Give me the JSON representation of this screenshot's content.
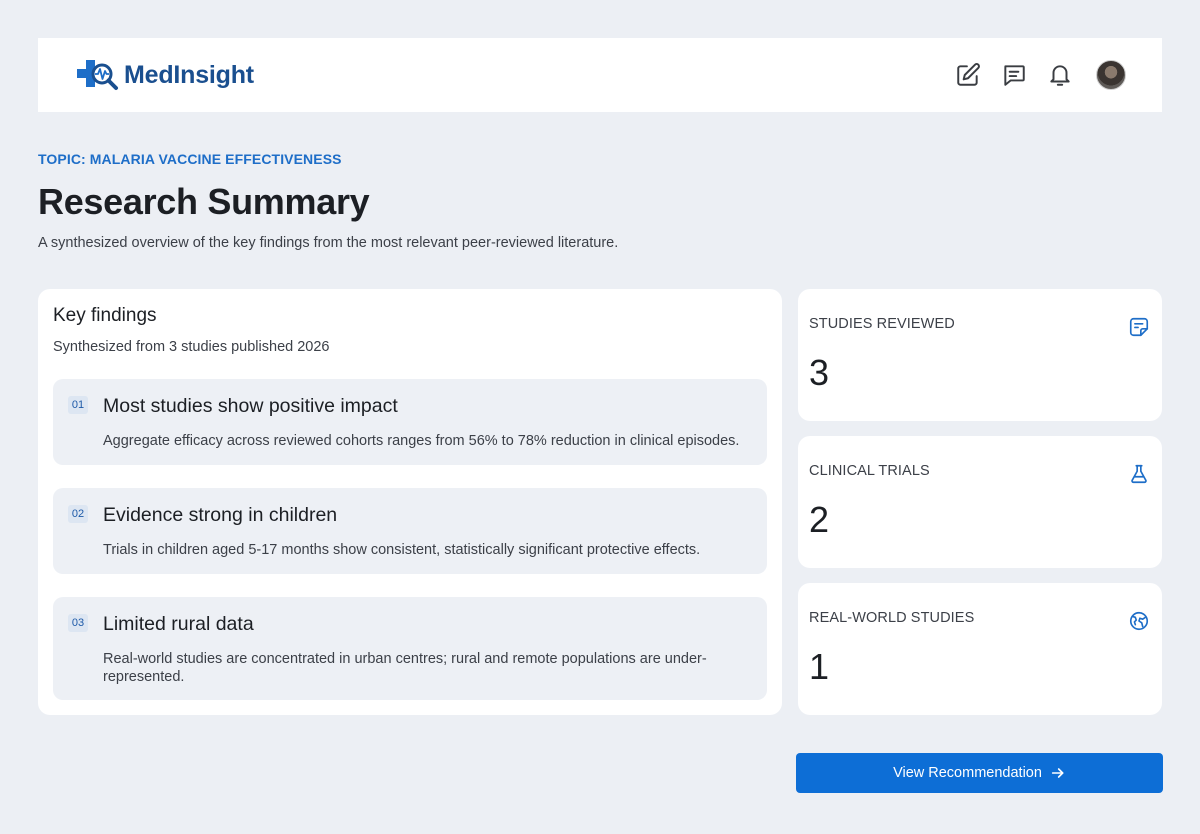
{
  "brand": {
    "name": "MedInsight",
    "accent": "#1e6ec8",
    "primary": "#0d6ed6"
  },
  "header": {
    "actions": [
      {
        "icon": "edit-icon"
      },
      {
        "icon": "message-icon"
      },
      {
        "icon": "bell-icon"
      }
    ],
    "avatar": "user-avatar"
  },
  "page": {
    "topic": "TOPIC: MALARIA VACCINE EFFECTIVENESS",
    "title": "Research Summary",
    "subtitle": "A synthesized overview of the key findings from the most relevant peer-reviewed literature."
  },
  "findings": {
    "title": "Key findings",
    "subtitle": "Synthesized from 3 studies published 2026",
    "items": [
      {
        "num": "01",
        "title": "Most studies show positive impact",
        "text": "Aggregate efficacy across reviewed cohorts ranges from 56% to 78% reduction in clinical episodes."
      },
      {
        "num": "02",
        "title": "Evidence strong in children",
        "text": "Trials in children aged 5-17 months show consistent, statistically significant protective effects."
      },
      {
        "num": "03",
        "title": "Limited rural data",
        "text": "Real-world studies are concentrated in urban centres; rural  and remote populations are under-represented."
      }
    ]
  },
  "stats": [
    {
      "label": "STUDIES REVIEWED",
      "value": "3",
      "icon": "note-icon"
    },
    {
      "label": "CLINICAL TRIALS",
      "value": "2",
      "icon": "flask-icon"
    },
    {
      "label": "REAL-WORLD STUDIES",
      "value": "1",
      "icon": "globe-icon"
    }
  ],
  "cta": {
    "label": "View Recommendation",
    "icon": "arrow-right-icon"
  }
}
